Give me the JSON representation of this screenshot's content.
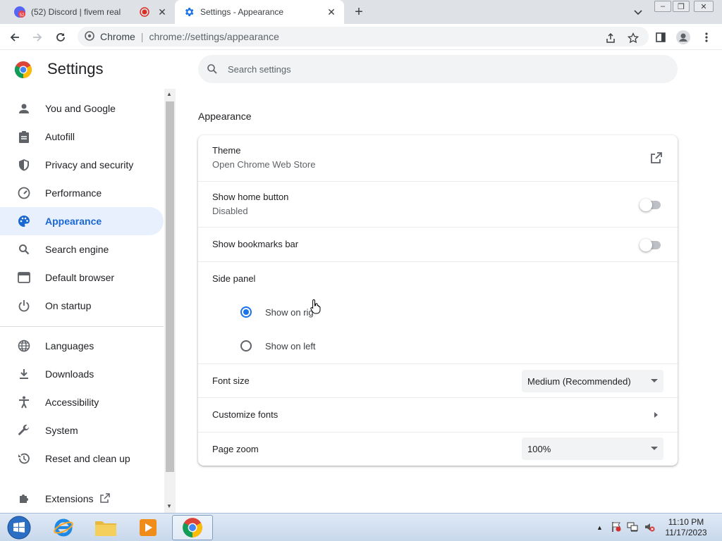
{
  "browser": {
    "tabs": [
      {
        "title": "(52) Discord | fivem real",
        "badge": "52",
        "active": false
      },
      {
        "title": "Settings - Appearance",
        "active": true
      }
    ],
    "omnibox": {
      "site": "Chrome",
      "url": "chrome://settings/appearance"
    }
  },
  "settings": {
    "title": "Settings",
    "search_placeholder": "Search settings",
    "nav": [
      {
        "label": "You and Google",
        "icon": "person-icon"
      },
      {
        "label": "Autofill",
        "icon": "clipboard-icon"
      },
      {
        "label": "Privacy and security",
        "icon": "shield-icon"
      },
      {
        "label": "Performance",
        "icon": "speedometer-icon"
      },
      {
        "label": "Appearance",
        "icon": "palette-icon",
        "active": true
      },
      {
        "label": "Search engine",
        "icon": "search-icon"
      },
      {
        "label": "Default browser",
        "icon": "browser-window-icon"
      },
      {
        "label": "On startup",
        "icon": "power-icon"
      },
      {
        "label": "Languages",
        "icon": "globe-icon"
      },
      {
        "label": "Downloads",
        "icon": "download-icon"
      },
      {
        "label": "Accessibility",
        "icon": "accessibility-icon"
      },
      {
        "label": "System",
        "icon": "wrench-icon"
      },
      {
        "label": "Reset and clean up",
        "icon": "history-icon"
      },
      {
        "label": "Extensions",
        "icon": "puzzle-icon"
      }
    ],
    "appearance": {
      "section_title": "Appearance",
      "theme": {
        "label": "Theme",
        "sub": "Open Chrome Web Store"
      },
      "home_button": {
        "label": "Show home button",
        "sub": "Disabled",
        "enabled": false
      },
      "bookmarks_bar": {
        "label": "Show bookmarks bar",
        "enabled": false
      },
      "side_panel": {
        "label": "Side panel",
        "options": [
          "Show on right",
          "Show on left"
        ],
        "selected": "Show on right",
        "visible_right_label": "Show on rig"
      },
      "font_size": {
        "label": "Font size",
        "value": "Medium (Recommended)"
      },
      "customize_fonts": {
        "label": "Customize fonts"
      },
      "page_zoom": {
        "label": "Page zoom",
        "value": "100%"
      }
    }
  },
  "taskbar": {
    "time": "11:10 PM",
    "date": "11/17/2023"
  },
  "colors": {
    "accent": "#1a73e8",
    "active_nav_bg": "#e8f0fe",
    "active_nav_text": "#1967d2"
  }
}
